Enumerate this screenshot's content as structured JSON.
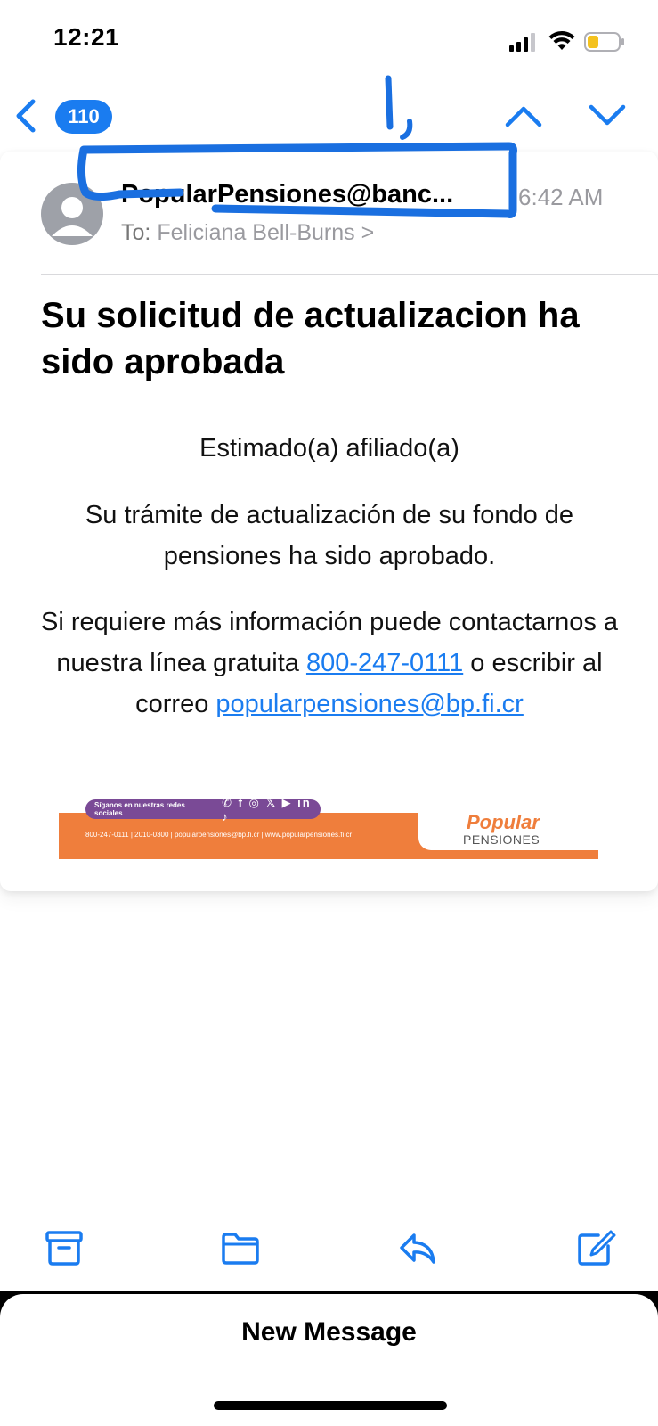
{
  "status_bar": {
    "time": "12:21",
    "signal_icon": "cellular-signal-icon",
    "wifi_icon": "wifi-icon",
    "battery_icon": "battery-low-icon"
  },
  "nav": {
    "back_icon": "chevron-left-icon",
    "unread_count": "110",
    "prev_icon": "chevron-up-icon",
    "next_icon": "chevron-down-icon"
  },
  "message": {
    "sender": "PopularPensiones@banc...",
    "time": "6:42 AM",
    "to_label": "To:",
    "to_name": "Feliciana Bell-Burns",
    "to_chevron": ">",
    "subject": "Su solicitud de actualizacion ha sido aprobada",
    "greeting": "Estimado(a) afiliado(a)",
    "paragraph1": "Su trámite de actualización de su fondo de pensiones ha sido aprobado.",
    "paragraph2_before": "Si requiere más información puede contactarnos a nuestra línea gratuita ",
    "phone_link": "800-247-0111",
    "paragraph2_middle": " o escribir al correo ",
    "email_link": "popularpensiones@bp.fi.cr"
  },
  "banner": {
    "social_text": "Síganos en nuestras redes sociales",
    "social_icons": "✆ f ◎ 𝕏 ▶ in ♪",
    "contact_line": "800-247-0111 | 2010-0300 | popularpensiones@bp.fi.cr | www.popularpensiones.fi.cr",
    "brand_name": "Popular",
    "brand_sub": "PENSIONES",
    "brand_color": "#ef7e3c",
    "social_color": "#7a4a96"
  },
  "toolbar": {
    "archive_icon": "archive-icon",
    "folder_icon": "move-to-folder-icon",
    "reply_icon": "reply-icon",
    "compose_icon": "compose-icon",
    "new_message": "New Message"
  },
  "colors": {
    "accent": "#1a7cf0",
    "annotation": "#1a6fe0",
    "secondary_text": "#9a9a9f"
  }
}
